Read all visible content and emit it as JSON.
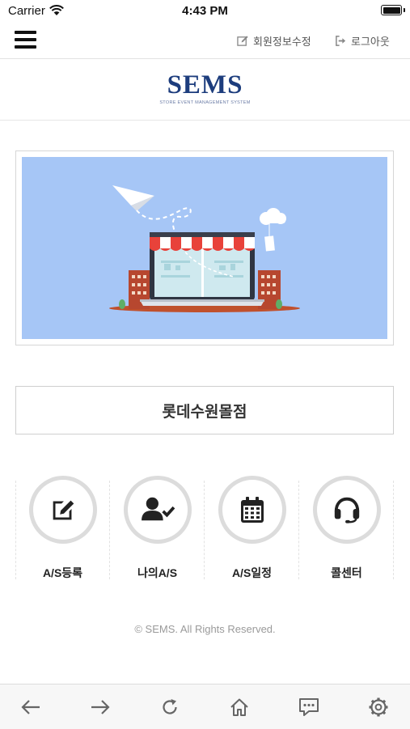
{
  "status_bar": {
    "carrier": "Carrier",
    "time": "4:43 PM",
    "icons": [
      "wifi-icon",
      "battery-icon"
    ]
  },
  "top_nav": {
    "menu_icon": "hamburger-menu-icon",
    "edit_profile": {
      "label": "회원정보수정",
      "icon": "edit-square-icon"
    },
    "logout": {
      "label": "로그아웃",
      "icon": "sign-out-icon"
    }
  },
  "logo": {
    "title": "SEMS",
    "subtitle": "STORE EVENT MANAGEMENT SYSTEM"
  },
  "banner": {
    "image": "store-laptop-illustration",
    "background_color": "#a6c6f6"
  },
  "store_name": "롯데수원몰점",
  "menu": [
    {
      "label": "A/S등록",
      "icon": "edit-icon"
    },
    {
      "label": "나의A/S",
      "icon": "user-check-icon"
    },
    {
      "label": "A/S일정",
      "icon": "calendar-icon"
    },
    {
      "label": "콜센터",
      "icon": "headset-icon"
    }
  ],
  "footer": {
    "copyright": "© SEMS. All Rights Reserved."
  },
  "bottom_toolbar": [
    "back-arrow-icon",
    "forward-arrow-icon",
    "reload-icon",
    "home-icon",
    "chat-icon",
    "settings-gear-icon"
  ],
  "colors": {
    "brand": "#1d3d7d",
    "banner_bg": "#a6c6f6",
    "awning_red": "#e8423a"
  }
}
